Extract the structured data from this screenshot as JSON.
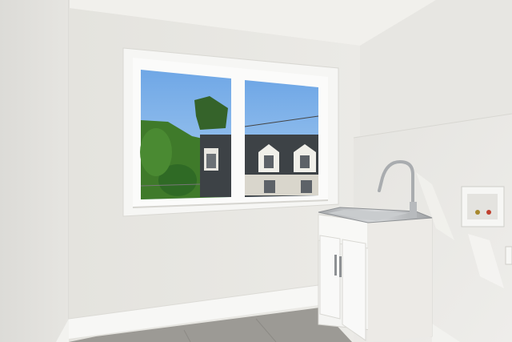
{
  "image": {
    "subject": "laundry-room",
    "palette": {
      "wall": "#e8e7e3",
      "ceiling": "#f1f0ec",
      "trim": "#f7f7f5",
      "floor": "#9c9a95",
      "sky": "#7fb3ea",
      "foliage": "#3f7a2a",
      "house_roof": "#3d4246",
      "steel": "#b9bcbf"
    },
    "icons": [
      "window-icon",
      "faucet-icon",
      "sink-icon",
      "cabinet-icon",
      "washer-box-icon"
    ]
  }
}
